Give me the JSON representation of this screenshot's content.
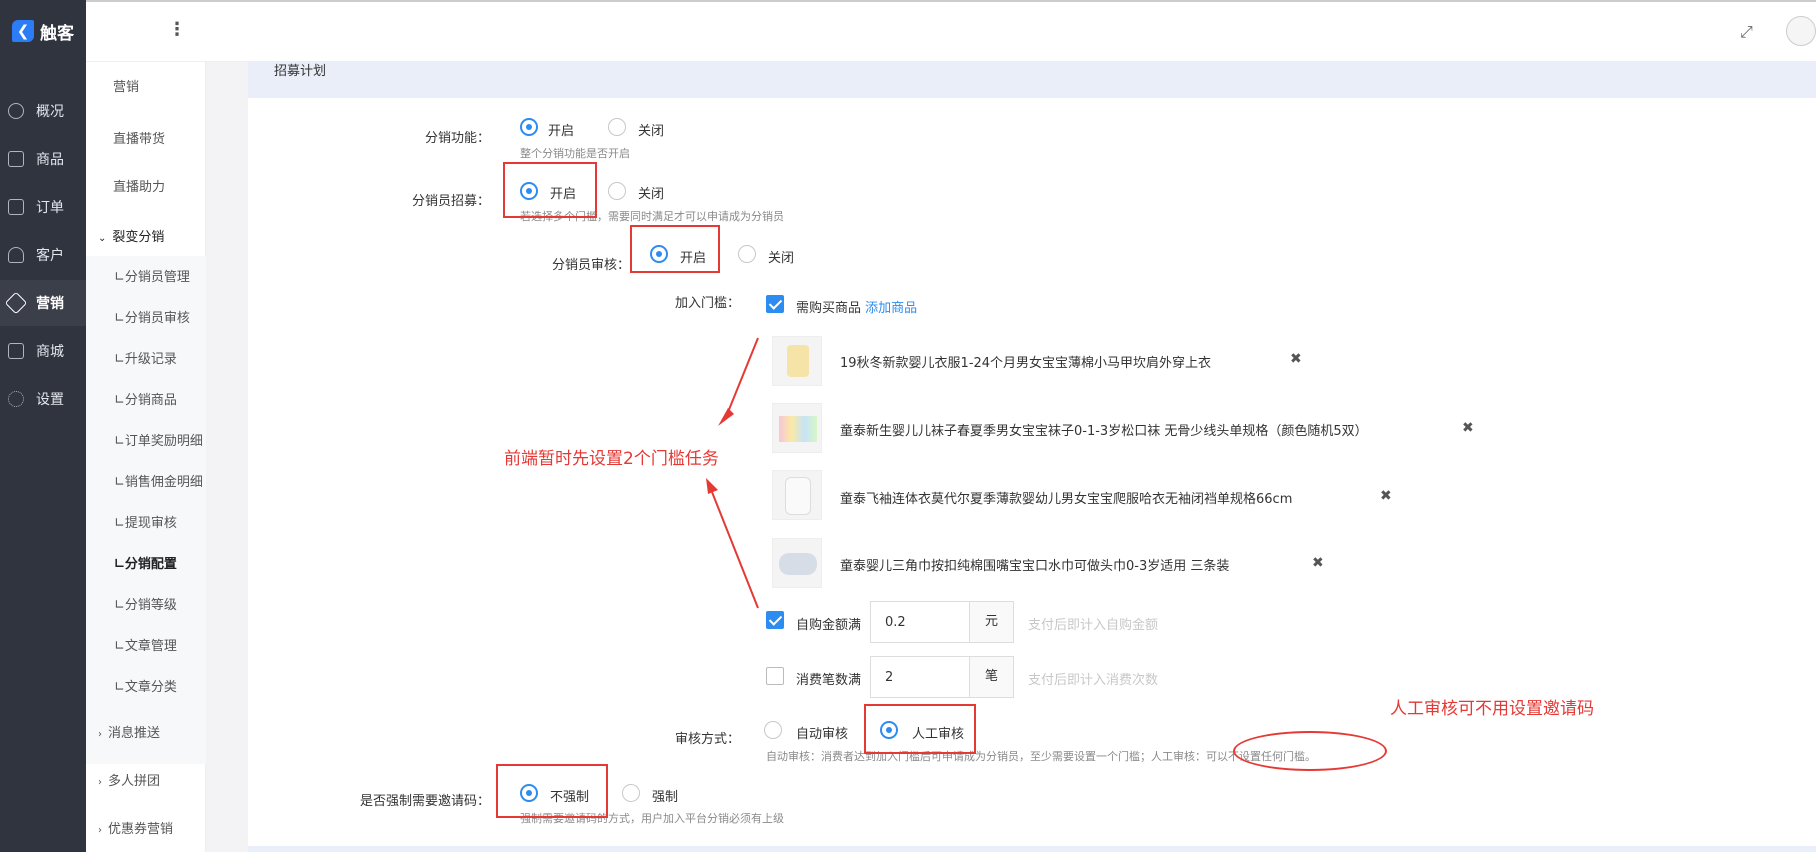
{
  "app": {
    "logo_text": "触客"
  },
  "nav": {
    "items": [
      {
        "label": "概况",
        "icon": "dashboard-icon"
      },
      {
        "label": "商品",
        "icon": "grid-icon"
      },
      {
        "label": "订单",
        "icon": "calendar-icon"
      },
      {
        "label": "客户",
        "icon": "user-icon"
      },
      {
        "label": "营销",
        "icon": "tag-icon",
        "active": true
      },
      {
        "label": "商城",
        "icon": "store-icon"
      },
      {
        "label": "设置",
        "icon": "gear-icon"
      }
    ]
  },
  "submenu": {
    "items": [
      "营销",
      "直播带货",
      "直播助力"
    ],
    "group_label": "裂变分销",
    "group_items": [
      "∟分销员管理",
      "∟分销员审核",
      "∟升级记录",
      "∟分销商品",
      "∟订单奖励明细",
      "∟销售佣金明细",
      "∟提现审核",
      "∟分销配置",
      "∟分销等级",
      "∟文章管理",
      "∟文章分类"
    ],
    "after_items": [
      "消息推送",
      "多人拼团",
      "优惠券营销"
    ]
  },
  "section_title": "招募计划",
  "form": {
    "distribution": {
      "label": "分销功能：",
      "on": "开启",
      "off": "关闭",
      "help": "整个分销功能是否开启"
    },
    "recruit": {
      "label": "分销员招募：",
      "on": "开启",
      "off": "关闭",
      "help": "若选择多个门槛，需要同时满足才可以申请成为分销员"
    },
    "review": {
      "label": "分销员审核：",
      "on": "开启",
      "off": "关闭"
    },
    "threshold": {
      "label": "加入门槛：",
      "buy_label": "需购买商品",
      "add_link": "添加商品",
      "products": [
        "19秋冬新款婴儿衣服1-24个月男女宝宝薄棉小马甲坎肩外穿上衣",
        "童泰新生婴儿儿袜子春夏季男女宝宝袜子0-1-3岁松口袜 无骨少线头单规格（颜色随机5双）",
        "童泰飞袖连体衣莫代尔夏季薄款婴幼儿男女宝宝爬服哈衣无袖闭裆单规格66cm",
        "童泰婴儿三角巾按扣纯棉围嘴宝宝口水巾可做头巾0-3岁适用 三条装"
      ],
      "amount_label": "自购金额满",
      "amount_value": "0.2",
      "amount_unit": "元",
      "amount_help": "支付后即计入自购金额",
      "count_label": "消费笔数满",
      "count_value": "2",
      "count_unit": "笔",
      "count_help": "支付后即计入消费次数"
    },
    "review_mode": {
      "label": "审核方式：",
      "auto": "自动审核",
      "manual": "人工审核",
      "help": "自动审核：消费者达到加入门槛后可申请成为分销员，至少需要设置一个门槛；人工审核：可以不设置任何门槛。"
    },
    "invite": {
      "label": "是否强制需要邀请码：",
      "no": "不强制",
      "yes": "强制",
      "help": "强制需要邀请码的方式，用户加入平台分销必须有上级"
    }
  },
  "annotations": {
    "note1": "前端暂时先设置2个门槛任务",
    "note2": "人工审核可不用设置邀请码"
  },
  "colors": {
    "accent": "#2d8cf0",
    "nav_bg": "#30343f",
    "annotation": "#e53935"
  }
}
